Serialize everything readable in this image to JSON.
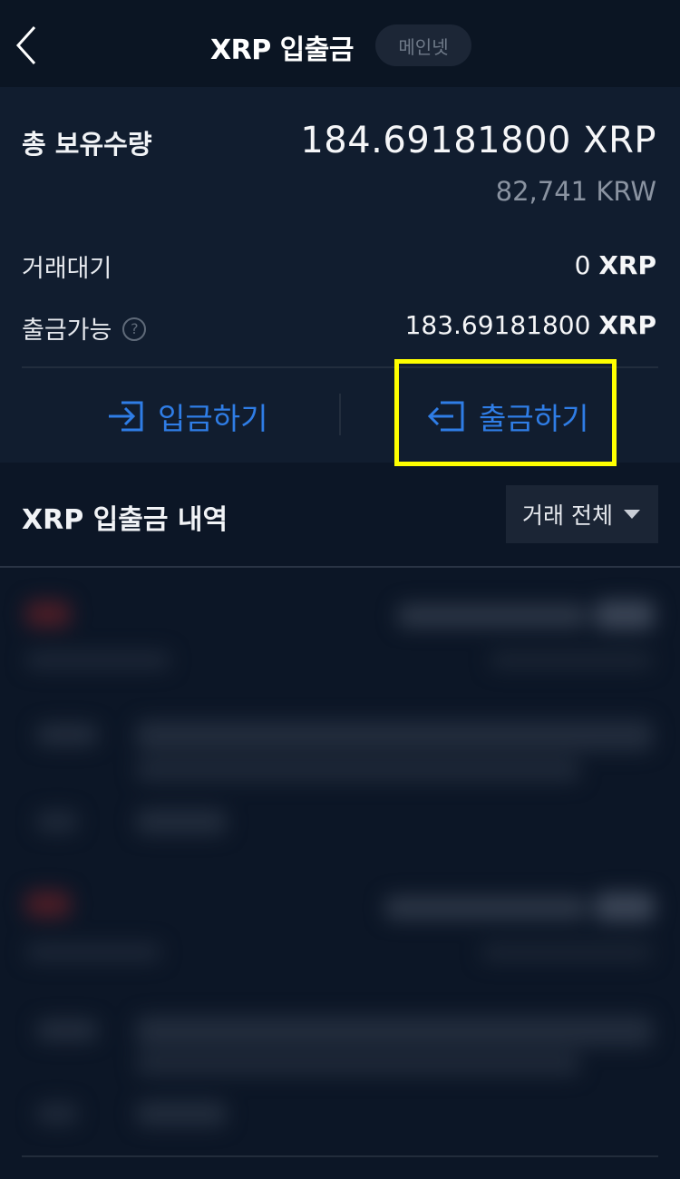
{
  "header": {
    "back_icon": "chevron-left-icon",
    "title": "XRP 입출금",
    "network_badge": "메인넷"
  },
  "summary": {
    "total_label": "총 보유수량",
    "total_amount": "184.69181800 XRP",
    "total_krw": "82,741 KRW",
    "pending_label": "거래대기",
    "pending_amount": "0",
    "pending_unit": "XRP",
    "withdrawable_label": "출금가능",
    "help_icon": "question-circle-icon",
    "withdrawable_amount": "183.69181800",
    "withdrawable_unit": "XRP"
  },
  "actions": {
    "deposit_label": "입금하기",
    "deposit_icon": "login-arrow-icon",
    "withdraw_label": "출금하기",
    "withdraw_icon": "logout-arrow-icon",
    "accent_color": "#2f7de6",
    "highlight_color": "#ffff00"
  },
  "history": {
    "title": "XRP 입출금 내역",
    "filter_label": "거래 전체",
    "filter_icon": "triangle-down-icon"
  }
}
